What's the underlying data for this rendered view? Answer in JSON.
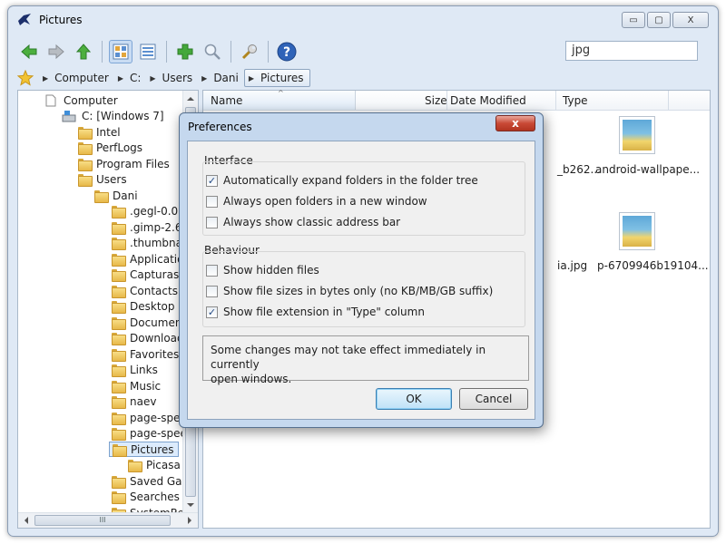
{
  "window": {
    "title": "Pictures"
  },
  "caption_buttons": {
    "minimize": "▭",
    "maximize": "▢",
    "close": "X"
  },
  "search": {
    "value": "jpg"
  },
  "address": {
    "crumbs": [
      "Computer",
      "C:",
      "Users",
      "Dani",
      "Pictures"
    ]
  },
  "tree": {
    "items": [
      "Computer",
      "C: [Windows 7]",
      "Intel",
      "PerfLogs",
      "Program Files",
      "Users",
      "Dani",
      ".gegl-0.0",
      ".gimp-2.6",
      ".thumbnails",
      "Application",
      "Capturas",
      "Contacts",
      "Desktop",
      "Documents",
      "Downloads",
      "Favorites",
      "Links",
      "Music",
      "naev",
      "page-speed",
      "page-speed",
      "Pictures",
      "Picasa",
      "Saved Game",
      "Searches",
      "SystemRequ"
    ]
  },
  "hscroll_grip": "III",
  "list": {
    "columns": {
      "name": "Name",
      "size": "Size",
      "date": "Date Modified",
      "type": "Type"
    },
    "files": [
      "_b262...",
      "android-wallpape...",
      "ia.jpg",
      "p-6709946b19104..."
    ]
  },
  "dialog": {
    "title": "Preferences",
    "close": "x",
    "interface": {
      "label": "Interface",
      "options": [
        {
          "label": "Automatically expand folders in the folder tree",
          "checked": true
        },
        {
          "label": "Always open folders in a new window",
          "checked": false
        },
        {
          "label": "Always show classic address bar",
          "checked": false
        }
      ]
    },
    "behaviour": {
      "label": "Behaviour",
      "options": [
        {
          "label": "Show hidden files",
          "checked": false
        },
        {
          "label": "Show file sizes in bytes only (no KB/MB/GB suffix)",
          "checked": false
        },
        {
          "label": "Show file extension in \"Type\" column",
          "checked": true
        }
      ]
    },
    "note_line1": "Some changes may not take effect immediately in currently",
    "note_line2": "open windows.",
    "ok": "OK",
    "cancel": "Cancel"
  },
  "colors": {
    "accent": "#3c7fb1",
    "close": "#c94a36"
  }
}
